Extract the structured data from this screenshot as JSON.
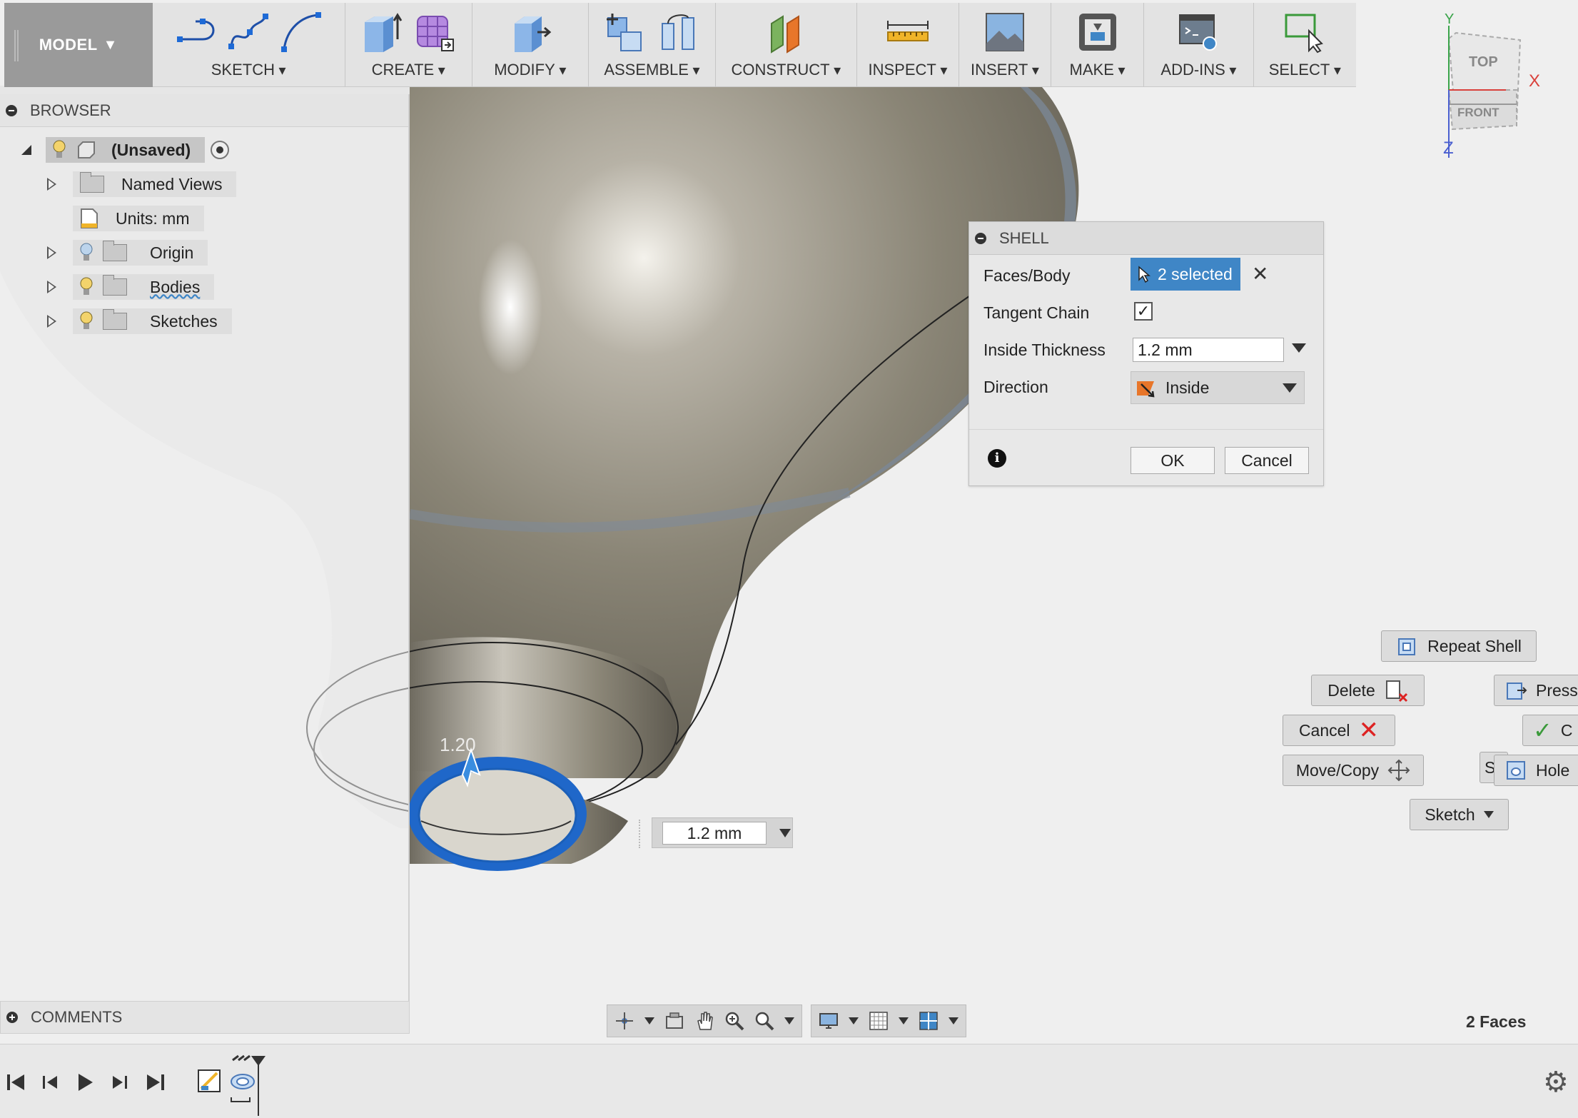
{
  "toolbar": {
    "workspace": "MODEL",
    "groups": {
      "sketch": "SKETCH",
      "create": "CREATE",
      "modify": "MODIFY",
      "assemble": "ASSEMBLE",
      "construct": "CONSTRUCT",
      "inspect": "INSPECT",
      "insert": "INSERT",
      "make": "MAKE",
      "addins": "ADD-INS",
      "select": "SELECT"
    }
  },
  "browser": {
    "title": "BROWSER",
    "root": "(Unsaved)",
    "items": {
      "named_views": "Named Views",
      "units": "Units: mm",
      "origin": "Origin",
      "bodies": "Bodies",
      "sketches": "Sketches"
    }
  },
  "comments": {
    "title": "COMMENTS"
  },
  "shell": {
    "title": "SHELL",
    "faces_label": "Faces/Body",
    "faces_value": "2 selected",
    "tangent_label": "Tangent Chain",
    "tangent_checked": true,
    "thickness_label": "Inside Thickness",
    "thickness_value": "1.2 mm",
    "direction_label": "Direction",
    "direction_value": "Inside",
    "ok_label": "OK",
    "cancel_label": "Cancel"
  },
  "viewport": {
    "dimension_value": "1.2 mm",
    "manipulator_label": "1.20",
    "faces_count": "2 Faces"
  },
  "marking_menu": {
    "repeat": "Repeat Shell",
    "delete": "Delete",
    "press": "Press",
    "cancel": "Cancel",
    "ok_partial": "C",
    "move_copy": "Move/Copy",
    "s_partial": "S",
    "hole": "Hole",
    "sketch": "Sketch"
  },
  "viewcube": {
    "top": "TOP",
    "front": "FRONT",
    "x": "X",
    "y": "Y",
    "z": "Z"
  },
  "colors": {
    "selection_blue": "#3f86c6",
    "body_gray": "#8c8778",
    "direction_orange": "#e8762a"
  }
}
